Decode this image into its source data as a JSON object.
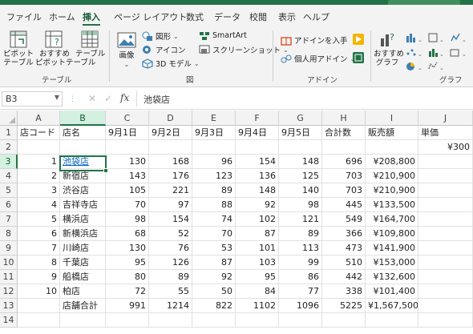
{
  "ribbon_tabs": [
    "ファイル",
    "ホーム",
    "挿入",
    "ページ レイアウト",
    "数式",
    "データ",
    "校閲",
    "表示",
    "ヘルプ"
  ],
  "active_tab": "挿入",
  "ribbon": {
    "pivot": {
      "line1": "ピボット",
      "line2": "テーブル"
    },
    "recommended_pivot": {
      "line1": "おすすめ",
      "line2": "ピボットテーブル"
    },
    "table": "テーブル",
    "group_table": "テーブル",
    "image": "画像",
    "shapes": "図形",
    "icons": "アイコン",
    "models3d": "3D モデル",
    "smartart": "SmartArt",
    "screenshot": "スクリーンショット",
    "group_figure": "図",
    "get_addins": "アドインを入手",
    "my_addins": "個人用アドイン",
    "group_addins": "アドイン",
    "recommended_charts": {
      "line1": "おすすめ",
      "line2": "グラフ"
    },
    "group_charts": "グラフ"
  },
  "formula_bar": {
    "name_box": "B3",
    "fx": "fx",
    "content": "池袋店"
  },
  "columns": [
    "A",
    "B",
    "C",
    "D",
    "E",
    "F",
    "G",
    "H",
    "I",
    "J"
  ],
  "rows": [
    "1",
    "2",
    "3",
    "4",
    "5",
    "6",
    "7",
    "8",
    "9",
    "10",
    "11",
    "12",
    "13",
    "14"
  ],
  "sheet": {
    "header": [
      "店コード",
      "店名",
      "9月1日",
      "9月2日",
      "9月3日",
      "9月4日",
      "9月5日",
      "合計数",
      "販売額",
      "単価"
    ],
    "unit_price": "¥300",
    "stores": [
      [
        "1",
        "池袋店",
        "130",
        "168",
        "96",
        "154",
        "148",
        "696",
        "¥208,800"
      ],
      [
        "2",
        "新宿店",
        "143",
        "176",
        "123",
        "136",
        "125",
        "703",
        "¥210,900"
      ],
      [
        "3",
        "渋谷店",
        "105",
        "221",
        "89",
        "148",
        "140",
        "703",
        "¥210,900"
      ],
      [
        "4",
        "吉祥寺店",
        "70",
        "97",
        "88",
        "92",
        "98",
        "445",
        "¥133,500"
      ],
      [
        "5",
        "横浜店",
        "98",
        "154",
        "74",
        "102",
        "121",
        "549",
        "¥164,700"
      ],
      [
        "6",
        "新横浜店",
        "68",
        "52",
        "70",
        "87",
        "89",
        "366",
        "¥109,800"
      ],
      [
        "7",
        "川崎店",
        "130",
        "76",
        "53",
        "101",
        "113",
        "473",
        "¥141,900"
      ],
      [
        "8",
        "千葉店",
        "95",
        "126",
        "87",
        "103",
        "99",
        "510",
        "¥153,000"
      ],
      [
        "9",
        "船橋店",
        "80",
        "89",
        "92",
        "95",
        "86",
        "442",
        "¥132,600"
      ],
      [
        "10",
        "柏店",
        "72",
        "55",
        "50",
        "84",
        "77",
        "338",
        "¥101,400"
      ]
    ],
    "total": [
      "",
      "店舗合計",
      "991",
      "1214",
      "822",
      "1102",
      "1096",
      "5225",
      "¥1,567,500"
    ]
  }
}
